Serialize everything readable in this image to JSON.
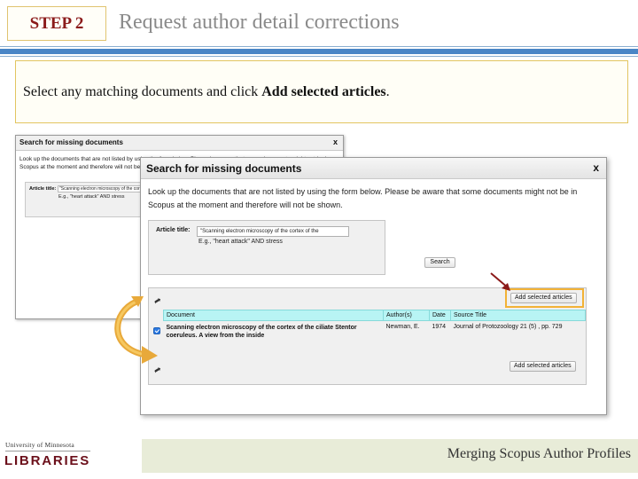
{
  "slide": {
    "step_label": "STEP 2",
    "title": "Request author detail corrections",
    "instruction_prefix": "Select any matching documents and click ",
    "instruction_bold": "Add selected articles",
    "instruction_suffix": "."
  },
  "bg_dialog": {
    "title": "Search for missing documents",
    "close": "x",
    "description": "Look up the documents that are not listed by using the form below. Please be aware that some documents might not be in Scopus at the moment and therefore will not be shown.",
    "article_label": "Article title:",
    "article_value": "\"Scanning electron microscopy of the cortex of th",
    "hint": "E.g., \"heart attack\" AND stress"
  },
  "dialog": {
    "title": "Search for missing documents",
    "close": "x",
    "description": "Look up the documents that are not listed by using the form below. Please be aware that some documents might not be in Scopus at the moment and therefore will not be shown.",
    "article_label": "Article title:",
    "article_value": "\"Scanning electron microscopy of the cortex of the",
    "hint": "E.g., \"heart attack\" AND stress",
    "search_button": "Search",
    "add_selected_top": "Add selected articles",
    "add_selected_bottom": "Add selected articles",
    "table": {
      "headers": [
        "Document",
        "Author(s)",
        "Date",
        "Source Title"
      ],
      "rows": [
        {
          "checked": true,
          "document": "Scanning electron microscopy of the cortex of the ciliate Stentor coeruleus. A view from the inside",
          "authors": "Newman, E.",
          "date": "1974",
          "source": "Journal of Protozoology 21 (5) , pp. 729"
        }
      ]
    }
  },
  "footer": {
    "university": "University of Minnesota",
    "libraries": "LIBRARIES",
    "text": "Merging Scopus Author Profiles"
  },
  "colors": {
    "accent_blue": "#4a86c6",
    "step_red": "#8b1a1a",
    "highlight_orange": "#f2b236",
    "table_header": "#b8f4f4",
    "umn_maroon": "#6b0f1a"
  }
}
